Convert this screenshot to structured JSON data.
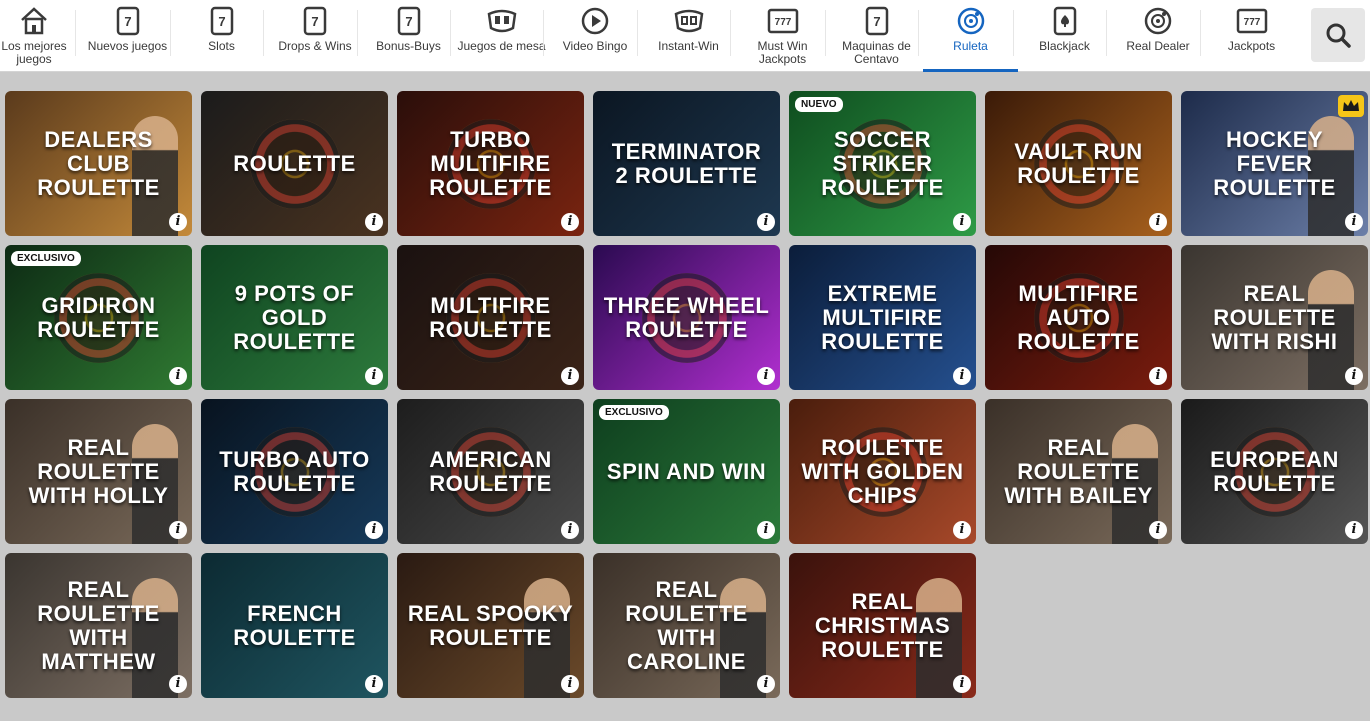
{
  "nav": {
    "items": [
      {
        "label": "Los mejores juegos",
        "icon": "home-icon"
      },
      {
        "label": "Nuevos juegos",
        "icon": "slot-machine-icon"
      },
      {
        "label": "Slots",
        "icon": "slot-machine-icon"
      },
      {
        "label": "Drops & Wins",
        "icon": "slot-machine-icon"
      },
      {
        "label": "Bonus-Buys",
        "icon": "slot-machine-icon"
      },
      {
        "label": "Juegos de mesa",
        "icon": "table-game-icon"
      },
      {
        "label": "Video Bingo",
        "icon": "play-icon"
      },
      {
        "label": "Instant-Win",
        "icon": "instant-win-icon"
      },
      {
        "label": "Must Win Jackpots",
        "icon": "jackpot-icon"
      },
      {
        "label": "Maquinas de Centavo",
        "icon": "slot-machine-icon"
      },
      {
        "label": "Ruleta",
        "icon": "roulette-icon",
        "active": true
      },
      {
        "label": "Blackjack",
        "icon": "playing-card-icon"
      },
      {
        "label": "Real Dealer",
        "icon": "roulette-icon"
      },
      {
        "label": "Jackpots",
        "icon": "jackpot-icon"
      }
    ],
    "search_icon": "search-icon",
    "accent": "#1565c0"
  },
  "games": [
    {
      "title": "Dealers Club Roulette",
      "badge": "",
      "bg": "linear-gradient(135deg,#5a3a1c,#c48a3a)",
      "deco": "person"
    },
    {
      "title": "Roulette",
      "badge": "",
      "bg": "linear-gradient(135deg,#1b1b1b,#4a3320)",
      "deco": "wheel"
    },
    {
      "title": "Turbo Multifire Roulette",
      "badge": "",
      "bg": "linear-gradient(135deg,#2a0e0a,#7a2410)",
      "deco": "wheel"
    },
    {
      "title": "Terminator 2 Roulette",
      "badge": "",
      "bg": "linear-gradient(135deg,#0b1622,#1e3850)",
      "deco": ""
    },
    {
      "title": "Soccer Striker Roulette",
      "badge": "NUEVO",
      "bg": "linear-gradient(135deg,#0f4d1f,#2e9b46)",
      "deco": "wheel"
    },
    {
      "title": "Vault Run Roulette",
      "badge": "",
      "bg": "linear-gradient(135deg,#3a1a08,#a8611d)",
      "deco": "wheel"
    },
    {
      "title": "Hockey Fever Roulette",
      "badge": "",
      "bg": "linear-gradient(135deg,#1d2b4a,#6c7fa8)",
      "deco": "person",
      "crown": true
    },
    {
      "title": "Gridiron Roulette",
      "badge": "EXCLUSIVO",
      "bg": "linear-gradient(135deg,#0d2a14,#2f7a32)",
      "deco": "wheel"
    },
    {
      "title": "9 Pots of Gold Roulette",
      "badge": "",
      "bg": "linear-gradient(135deg,#0f4420,#2d7a3c)",
      "deco": ""
    },
    {
      "title": "Multifire Roulette",
      "badge": "",
      "bg": "linear-gradient(135deg,#1a1110,#3b2418)",
      "deco": "wheel"
    },
    {
      "title": "Three Wheel Roulette",
      "badge": "",
      "bg": "linear-gradient(135deg,#2a0a50,#b12fd0)",
      "deco": "wheel"
    },
    {
      "title": "Extreme Multifire Roulette",
      "badge": "",
      "bg": "linear-gradient(135deg,#0b1d3a,#25508f)",
      "deco": ""
    },
    {
      "title": "Multifire Auto Roulette",
      "badge": "",
      "bg": "linear-gradient(135deg,#250806,#7a1c0e)",
      "deco": "wheel"
    },
    {
      "title": "Real Roulette with Rishi",
      "badge": "",
      "bg": "linear-gradient(135deg,#3a3530,#7d6f63)",
      "deco": "person"
    },
    {
      "title": "Real Roulette with Holly",
      "badge": "",
      "bg": "linear-gradient(135deg,#3a3028,#7a6a5a)",
      "deco": "person"
    },
    {
      "title": "Turbo Auto Roulette",
      "badge": "",
      "bg": "linear-gradient(135deg,#08131f,#163a5a)",
      "deco": "wheel"
    },
    {
      "title": "American Roulette",
      "badge": "",
      "bg": "linear-gradient(135deg,#1d1d1d,#4a4a4a)",
      "deco": "wheel"
    },
    {
      "title": "Spin and Win",
      "badge": "EXCLUSIVO",
      "bg": "linear-gradient(135deg,#0e3e1e,#2b7a3a)",
      "deco": ""
    },
    {
      "title": "Roulette with Golden Chips",
      "badge": "",
      "bg": "linear-gradient(135deg,#4a1d0c,#a8492a)",
      "deco": "wheel"
    },
    {
      "title": "Real Roulette with Bailey",
      "badge": "",
      "bg": "linear-gradient(135deg,#3a3028,#7a6a5a)",
      "deco": "person"
    },
    {
      "title": "European Roulette",
      "badge": "",
      "bg": "linear-gradient(135deg,#1a1a1a,#555555)",
      "deco": "wheel"
    },
    {
      "title": "Real Roulette with Matthew",
      "badge": "",
      "bg": "linear-gradient(135deg,#3a3530,#7d6f63)",
      "deco": "person"
    },
    {
      "title": "French Roulette",
      "badge": "",
      "bg": "linear-gradient(135deg,#0c2a32,#1f5560)",
      "deco": ""
    },
    {
      "title": "Real Spooky Roulette",
      "badge": "",
      "bg": "linear-gradient(135deg,#2a1a12,#6b4a2a)",
      "deco": "person"
    },
    {
      "title": "Real Roulette with Caroline",
      "badge": "",
      "bg": "linear-gradient(135deg,#3a3028,#7a6a5a)",
      "deco": "person"
    },
    {
      "title": "Real Christmas Roulette",
      "badge": "",
      "bg": "linear-gradient(135deg,#3a120c,#8a2a1a)",
      "deco": "person"
    }
  ],
  "info_glyph": "i"
}
